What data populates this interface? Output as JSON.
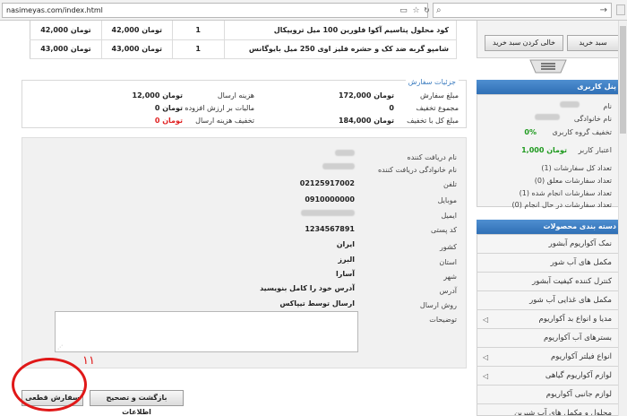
{
  "browser": {
    "url": "nasimeyas.com/index.html",
    "search_placeholder": ""
  },
  "products": [
    {
      "name": "کود محلول پتاسیم آکوا فلورین 100 میل ترویپکال",
      "quantity": "1",
      "price": "42,000 تومان",
      "total": "42,000 تومان"
    },
    {
      "name": "شامپو گربه ضد کک و حشره فلیز اوی 250 میل بایوگانس",
      "quantity": "1",
      "price": "43,000 تومان",
      "total": "43,000 تومان"
    }
  ],
  "order_details": {
    "legend": "جزئیات سفارش",
    "order_amount_label": "مبلغ سفارش",
    "order_amount": "172,000 تومان",
    "discount_total_label": "مجموع تخفیف",
    "discount_total": "0",
    "grand_total_label": "مبلغ کل با تخفیف",
    "grand_total": "184,000 تومان",
    "shipping_label": "هزینه ارسال",
    "shipping": "12,000 تومان",
    "vat_label": "مالیات بر ارزش افزوده",
    "vat": "0 تومان",
    "shipping_discount_label": "تخفیف هزینه ارسال",
    "shipping_discount": "0 تومان",
    "shipping_discount_color": "#e02020"
  },
  "recipient": {
    "first_name_label": "نام دریافت کننده",
    "last_name_label": "نام خانوادگی دریافت کننده",
    "phone_label": "تلفن",
    "phone": "02125917002",
    "mobile_label": "موبایل",
    "mobile": "0910000000",
    "email_label": "ایمیل",
    "postal_label": "کد پستی",
    "postal": "1234567891",
    "country_label": "کشور",
    "country": "ایران",
    "province_label": "استان",
    "province": "البرز",
    "city_label": "شهر",
    "city": "آسارا",
    "address_label": "آدرس",
    "address": "آدرس خود را کامل بنویسید",
    "method_label": "روش ارسال",
    "method": "ارسال توسط تیپاکس",
    "notes_label": "توضیحات"
  },
  "buttons": {
    "back_label": "بازگشت و تصحیح اطلاعات",
    "final_label": "سفارش قطعی",
    "annotation_mark": "۱۱"
  },
  "sidebar": {
    "cart_buy_label": "سبد خرید",
    "cart_empty_label": "خالی کردن سبد خرید",
    "user_panel": {
      "title": "پنل کاربری",
      "name_label": "نام",
      "family_label": "نام خانوادگی",
      "group_discount_label": "تخفیف گروه کاربری",
      "group_discount": "0%",
      "credit_label": "اعتبار کاربر",
      "credit": "1,000 تومان",
      "total_orders_label": "تعداد کل سفارشات (1)",
      "pending_orders_label": "تعداد سفارشات معلق (0)",
      "done_orders_label": "تعداد سفارشات انجام شده (1)",
      "inprogress_orders_label": "تعداد سفارشات در حال انجام (0)",
      "accent_color": "#1f9a1f"
    },
    "categories": {
      "title": "دسته بندی محصولات",
      "items": [
        {
          "label": "نمک آکواریوم آبشور",
          "has_sub": false
        },
        {
          "label": "مکمل های آب شور",
          "has_sub": false
        },
        {
          "label": "کنترل کننده کیفیت آبشور",
          "has_sub": false
        },
        {
          "label": "مکمل های غذایی آب شور",
          "has_sub": false
        },
        {
          "label": "مدیا و انواع بد آکواریوم",
          "has_sub": true
        },
        {
          "label": "بسترهای آب آکواریوم",
          "has_sub": false
        },
        {
          "label": "انواع فیلتر آکواریوم",
          "has_sub": true
        },
        {
          "label": "لوازم آکواریوم گیاهی",
          "has_sub": true
        },
        {
          "label": "لوازم جانبی آکواریوم",
          "has_sub": false
        },
        {
          "label": "محلول و مکمل های آب شیرین",
          "has_sub": false
        }
      ]
    }
  }
}
